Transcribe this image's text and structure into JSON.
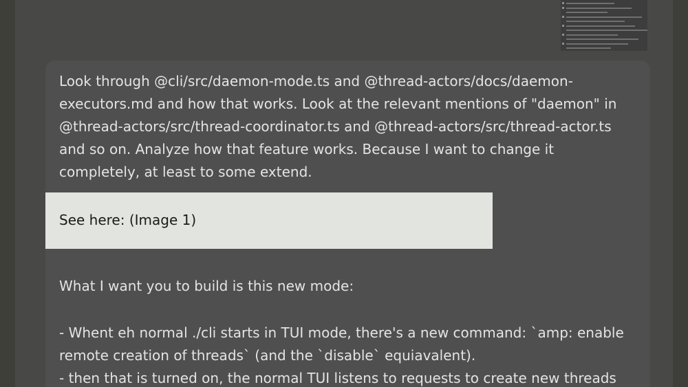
{
  "message": {
    "paragraph1": [
      "Look through @cli/src/daemon-mode.ts and @thread-actors/docs/daemon-",
      "executors.md and how that works. Look at the relevant mentions of \"daemon\" in",
      "@thread-actors/src/thread-coordinator.ts and @thread-actors/src/thread-actor.ts",
      "and so on. Analyze how that feature works. Because I want to change it",
      "completely, at least to some extend."
    ],
    "attachment_label": "See here: (Image 1)",
    "paragraph2": "What I want you to build is this new mode:",
    "bullets": [
      "- Whent eh normal ./cli starts in TUI mode, there's a new command: `amp: enable",
      "remote creation of threads` (and the `disable` equiavalent).",
      "- then that is turned on, the normal TUI listens to requests to create new threads"
    ]
  },
  "colors": {
    "background": "#3f3f3a",
    "panel": "#484847",
    "bubble": "#4f4f4f",
    "text": "#e4e4e4",
    "attachment_bg": "#e2e4df"
  }
}
